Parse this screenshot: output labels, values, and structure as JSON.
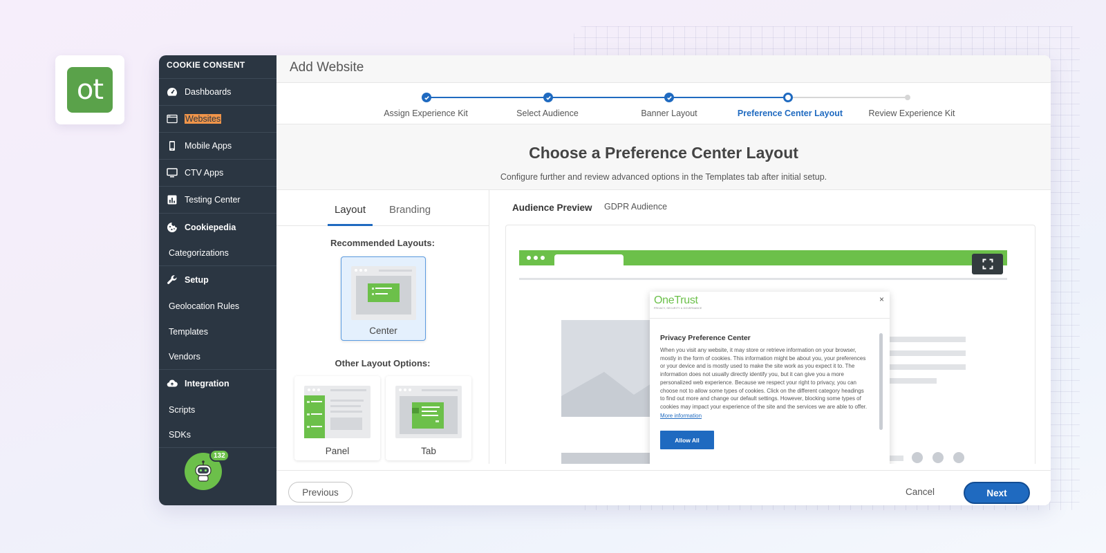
{
  "logo": {
    "text": "ot",
    "color": "#5aa24a"
  },
  "sidebar": {
    "title": "COOKIE CONSENT",
    "items": [
      {
        "label": "Dashboards",
        "icon": "dashboard-icon"
      },
      {
        "label": "Websites",
        "icon": "browser-window-icon",
        "highlighted": true
      },
      {
        "label": "Mobile Apps",
        "icon": "mobile-icon"
      },
      {
        "label": "CTV Apps",
        "icon": "monitor-icon"
      },
      {
        "label": "Testing Center",
        "icon": "bar-chart-icon"
      }
    ],
    "groups": [
      {
        "label": "Cookiepedia",
        "icon": "cookie-icon",
        "children": [
          "Categorizations"
        ]
      },
      {
        "label": "Setup",
        "icon": "wrench-icon",
        "children": [
          "Geolocation Rules",
          "Templates",
          "Vendors"
        ]
      },
      {
        "label": "Integration",
        "icon": "cloud-upload-icon",
        "children": [
          "Scripts",
          "SDKs"
        ]
      }
    ],
    "assistant_badge": "132"
  },
  "header": {
    "title": "Add Website"
  },
  "stepper": {
    "steps": [
      {
        "label": "Assign Experience Kit",
        "state": "done"
      },
      {
        "label": "Select Audience",
        "state": "done"
      },
      {
        "label": "Banner Layout",
        "state": "done"
      },
      {
        "label": "Preference Center Layout",
        "state": "current"
      },
      {
        "label": "Review Experience Kit",
        "state": "upcoming"
      }
    ],
    "accent": "#1f6ac0"
  },
  "page": {
    "title": "Choose a Preference Center Layout",
    "subtitle": "Configure further and review advanced options in the Templates tab after initial setup."
  },
  "left_panel": {
    "tabs": [
      "Layout",
      "Branding"
    ],
    "active_tab": "Layout",
    "recommended_label": "Recommended Layouts:",
    "recommended": [
      {
        "label": "Center",
        "selected": true
      }
    ],
    "other_label": "Other Layout Options:",
    "other": [
      {
        "label": "Panel"
      },
      {
        "label": "Tab"
      }
    ]
  },
  "preview": {
    "label": "Audience Preview",
    "audience": "GDPR Audience",
    "modal": {
      "brand": "OneTrust",
      "brand_tagline": "PRIVACY, SECURITY & GOVERNANCE",
      "close": "×",
      "title": "Privacy Preference Center",
      "body": "When you visit any website, it may store or retrieve information on your browser, mostly in the form of cookies. This information might be about you, your preferences or your device and is mostly used to make the site work as you expect it to. The information does not usually directly identify you, but it can give you a more personalized web experience. Because we respect your right to privacy, you can choose not to allow some types of cookies. Click on the different category headings to find out more and change our default settings. However, blocking some types of cookies may impact your experience of the site and the services we are able to offer.",
      "more_link": "More information",
      "allow_button": "Allow All"
    },
    "brand_green": "#6cc04a"
  },
  "footer": {
    "previous": "Previous",
    "cancel": "Cancel",
    "next": "Next"
  }
}
